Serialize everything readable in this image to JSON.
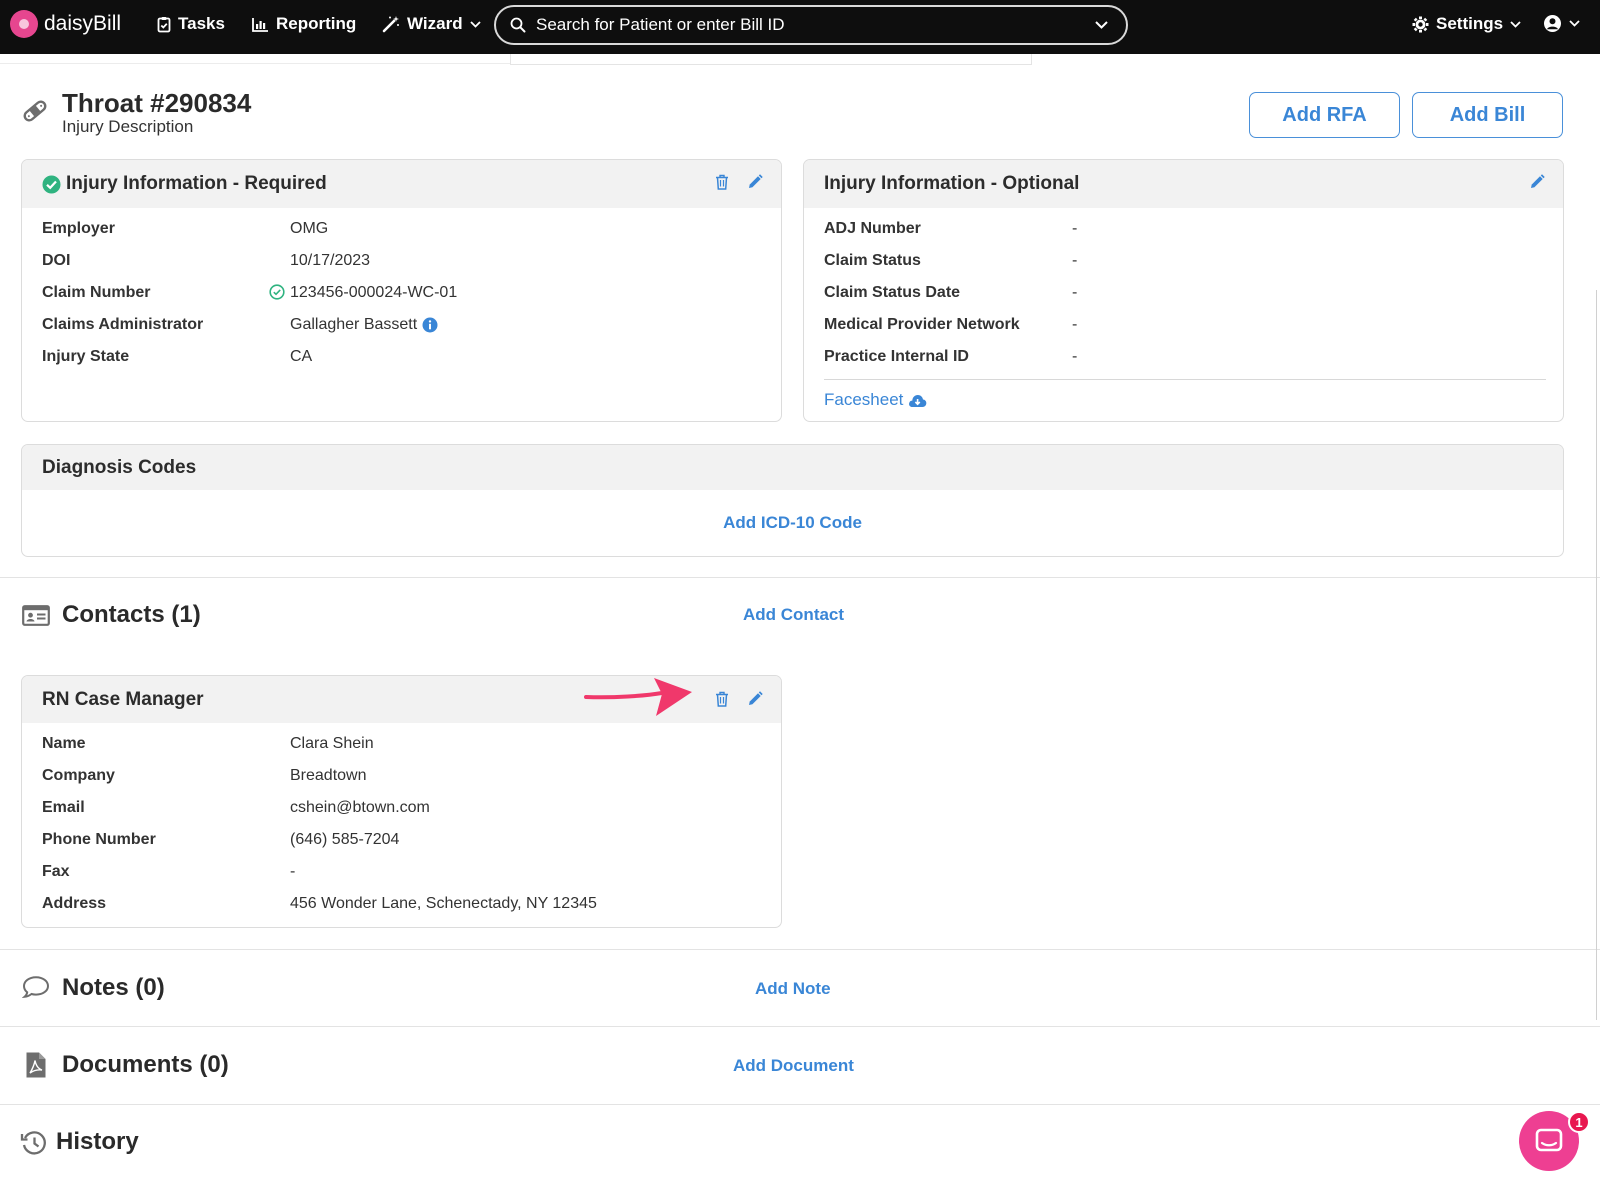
{
  "nav": {
    "brand": "daisyBill",
    "tasks": "Tasks",
    "reporting": "Reporting",
    "wizard": "Wizard",
    "search_placeholder": "Search for Patient or enter Bill ID",
    "settings": "Settings"
  },
  "header": {
    "title": "Throat #290834",
    "subtitle": "Injury Description",
    "add_rfa": "Add RFA",
    "add_bill": "Add Bill"
  },
  "injury_required": {
    "title": "Injury Information - Required",
    "rows": [
      {
        "label": "Employer",
        "value": "OMG"
      },
      {
        "label": "DOI",
        "value": "10/17/2023"
      },
      {
        "label": "Claim Number",
        "value": "123456-000024-WC-01"
      },
      {
        "label": "Claims Administrator",
        "value": "Gallagher Bassett"
      },
      {
        "label": "Injury State",
        "value": "CA"
      }
    ]
  },
  "injury_optional": {
    "title": "Injury Information - Optional",
    "rows": [
      {
        "label": "ADJ Number",
        "value": "-"
      },
      {
        "label": "Claim Status",
        "value": "-"
      },
      {
        "label": "Claim Status Date",
        "value": "-"
      },
      {
        "label": "Medical Provider Network",
        "value": "-"
      },
      {
        "label": "Practice Internal ID",
        "value": "-"
      }
    ],
    "facesheet": "Facesheet"
  },
  "diagnosis": {
    "title": "Diagnosis Codes",
    "add": "Add ICD-10 Code"
  },
  "contacts": {
    "title": "Contacts (1)",
    "add": "Add Contact",
    "card": {
      "title": "RN Case Manager",
      "rows": [
        {
          "label": "Name",
          "value": "Clara Shein"
        },
        {
          "label": "Company",
          "value": "Breadtown"
        },
        {
          "label": "Email",
          "value": "cshein@btown.com"
        },
        {
          "label": "Phone Number",
          "value": "(646) 585-7204"
        },
        {
          "label": "Fax",
          "value": "-"
        },
        {
          "label": "Address",
          "value": "456 Wonder Lane, Schenectady, NY 12345"
        }
      ]
    }
  },
  "notes": {
    "title": "Notes (0)",
    "add": "Add Note"
  },
  "documents": {
    "title": "Documents (0)",
    "add": "Add Document"
  },
  "history": {
    "title": "History"
  },
  "chat": {
    "badge": "1"
  },
  "colors": {
    "accent": "#3a86d6",
    "arrow": "#f0386b",
    "brand_pink": "#e6468f",
    "success": "#2fb380"
  }
}
